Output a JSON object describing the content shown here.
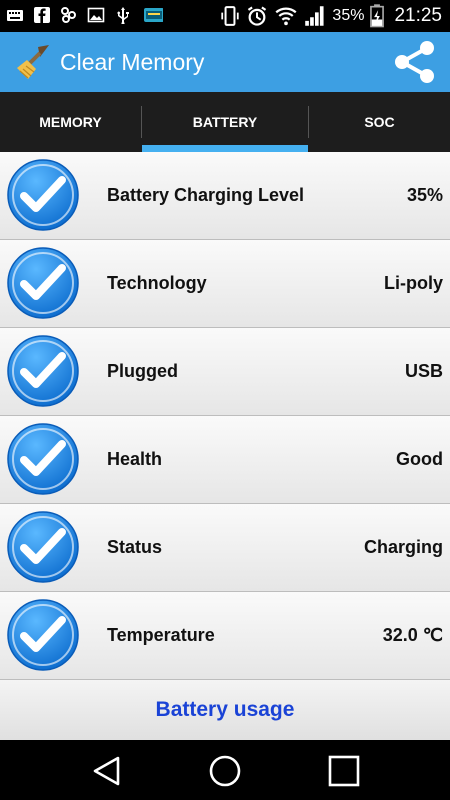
{
  "status_bar": {
    "battery_percent": "35%",
    "time": "21:25",
    "notification_icons": [
      "keyboard-icon",
      "facebook-icon",
      "share-app-icon",
      "image-icon",
      "usb-icon",
      "file-app-icon"
    ],
    "system_icons": [
      "vibrate-icon",
      "alarm-icon",
      "wifi-icon",
      "signal-icon",
      "battery-icon"
    ]
  },
  "app_bar": {
    "title": "Clear Memory",
    "share_icon": "share-icon",
    "logo_icon": "broom-icon"
  },
  "tabs": [
    {
      "label": "MEMORY",
      "selected": false
    },
    {
      "label": "BATTERY",
      "selected": true
    },
    {
      "label": "SOC",
      "selected": false
    }
  ],
  "battery_list": [
    {
      "label": "Battery Charging Level",
      "value": "35%"
    },
    {
      "label": "Technology",
      "value": "Li-poly"
    },
    {
      "label": "Plugged",
      "value": "USB"
    },
    {
      "label": "Health",
      "value": "Good"
    },
    {
      "label": "Status",
      "value": "Charging"
    },
    {
      "label": "Temperature",
      "value": "32.0 ℃"
    }
  ],
  "usage_button": {
    "label": "Battery usage"
  },
  "colors": {
    "accent": "#3d9fe3",
    "tab_indicator": "#45b0f0",
    "usage_link": "#1a43d6",
    "check_blue": "#1e88e5"
  }
}
